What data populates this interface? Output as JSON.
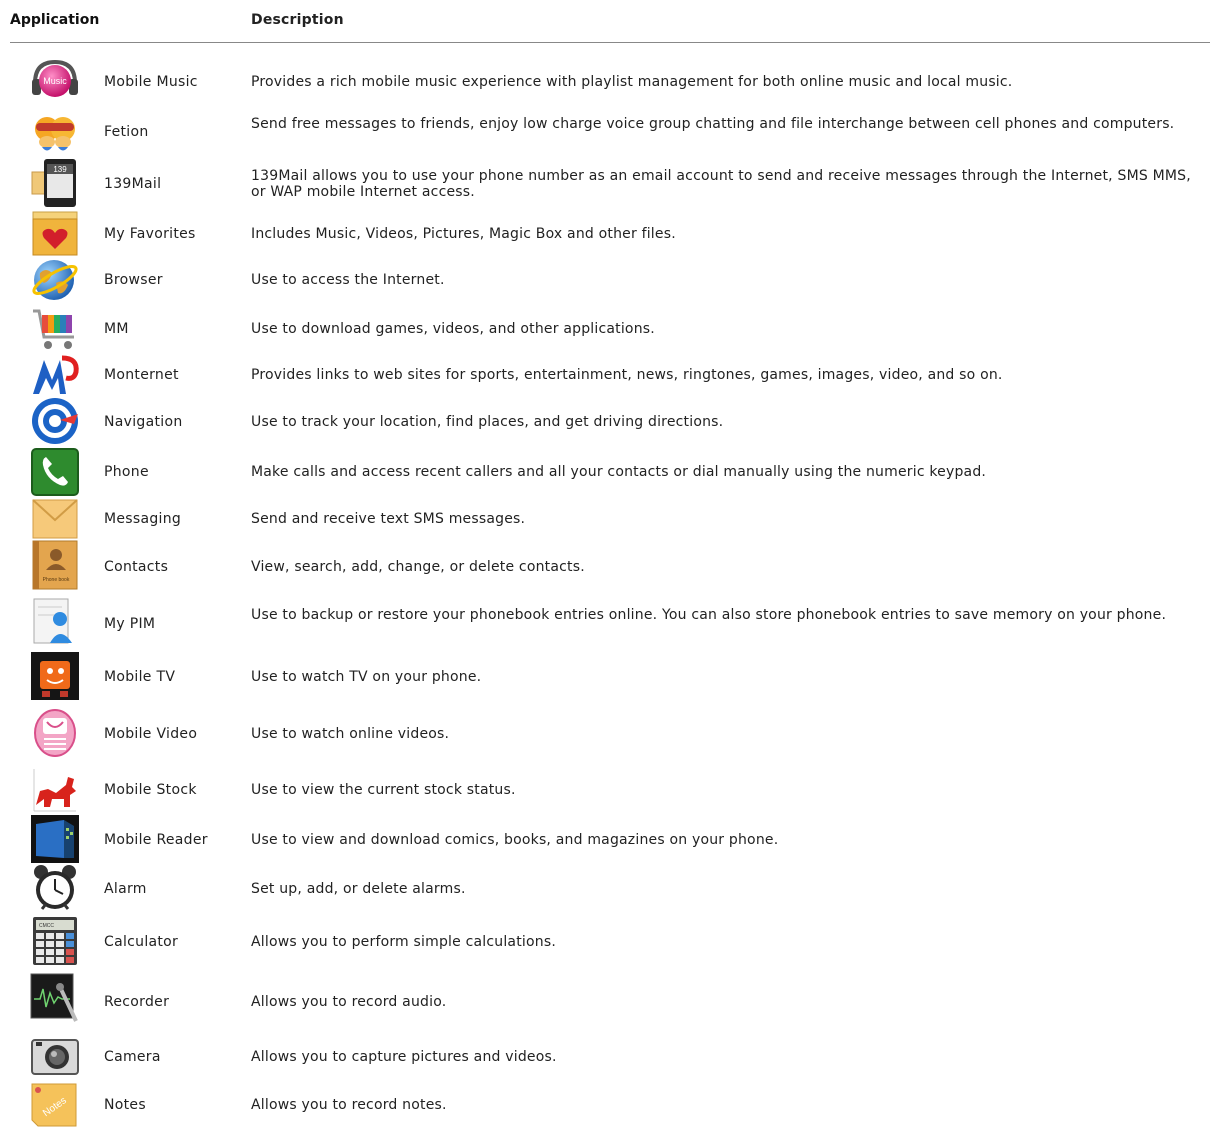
{
  "header": {
    "application": "Application",
    "description": "Description"
  },
  "rows": [
    {
      "icon": "music-icon",
      "icon_text": "Music",
      "name": "Mobile Music",
      "desc": "Provides a rich mobile music experience with playlist management for both online music and local music."
    },
    {
      "icon": "fetion-icon",
      "name": "Fetion",
      "desc": "Send free messages to friends, enjoy low charge voice group chatting and file interchange between cell phones and computers."
    },
    {
      "icon": "mail-icon",
      "icon_text": "139",
      "name": "139Mail",
      "desc": "139Mail allows you to use your phone number as an email account to send and receive messages through the Internet, SMS MMS, or WAP mobile Internet access."
    },
    {
      "icon": "favorites-icon",
      "name": "My Favorites",
      "desc": "Includes Music, Videos, Pictures, Magic Box and other files."
    },
    {
      "icon": "browser-icon",
      "name": "Browser",
      "desc": "Use to access the Internet."
    },
    {
      "icon": "mm-cart-icon",
      "name": "MM",
      "desc": "Use to download games, videos, and other applications."
    },
    {
      "icon": "monternet-icon",
      "name": "Monternet",
      "desc": "Provides links to web sites for sports, entertainment, news, ringtones, games, images, video, and so on."
    },
    {
      "icon": "navigation-icon",
      "name": "Navigation",
      "desc": "Use to track your location, find places, and get driving directions."
    },
    {
      "icon": "phone-icon",
      "name": "Phone",
      "desc": "Make calls and access recent callers and all your contacts or dial manually using the numeric keypad."
    },
    {
      "icon": "envelope-icon",
      "name": "Messaging",
      "desc": "Send and receive text SMS messages."
    },
    {
      "icon": "contacts-book-icon",
      "icon_text": "Phone book",
      "name": "Contacts",
      "desc": "View, search, add, change, or delete contacts."
    },
    {
      "icon": "pim-icon",
      "name": "My PIM",
      "desc": "Use to backup or restore your phonebook entries online. You can also store phonebook entries to save memory on your phone."
    },
    {
      "icon": "tv-icon",
      "name": "Mobile TV",
      "desc": "Use to watch TV on your phone."
    },
    {
      "icon": "video-icon",
      "name": "Mobile Video",
      "desc": "Use to watch online videos."
    },
    {
      "icon": "stock-bull-icon",
      "name": "Mobile Stock",
      "desc": "Use to view the current stock status."
    },
    {
      "icon": "reader-icon",
      "name": "Mobile Reader",
      "desc": "Use to view and download comics, books, and magazines on your phone."
    },
    {
      "icon": "alarm-clock-icon",
      "name": "Alarm",
      "desc": "Set up, add, or delete alarms."
    },
    {
      "icon": "calculator-icon",
      "icon_text": "CMCC",
      "name": "Calculator",
      "desc": "Allows you to perform simple calculations."
    },
    {
      "icon": "recorder-icon",
      "name": "Recorder",
      "desc": "Allows you to record audio."
    },
    {
      "icon": "camera-icon",
      "name": "Camera",
      "desc": "Allows you to capture pictures and videos."
    },
    {
      "icon": "notes-icon",
      "icon_text": "Notes",
      "name": "Notes",
      "desc": "Allows you to record notes."
    }
  ]
}
